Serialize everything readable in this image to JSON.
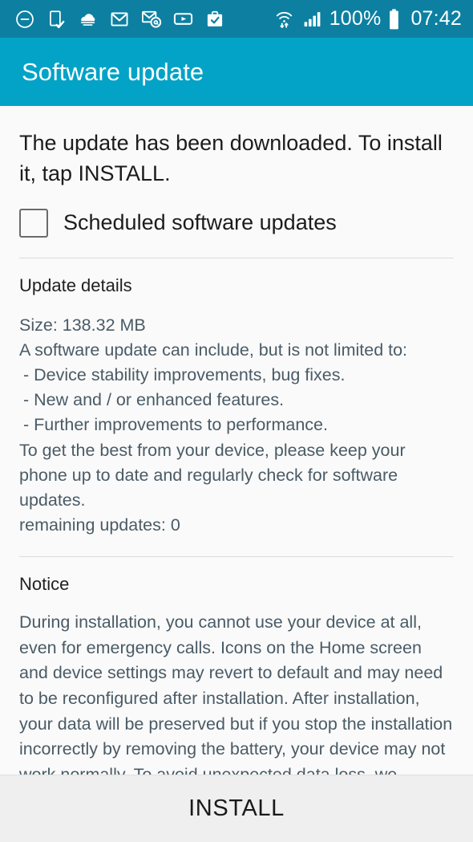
{
  "status_bar": {
    "background_color": "#0d80a2",
    "left_icons": [
      {
        "name": "do-not-disturb-icon",
        "glyph": "⊖"
      },
      {
        "name": "device-check-icon",
        "glyph": "device"
      },
      {
        "name": "cloud-icon",
        "glyph": "cloud"
      },
      {
        "name": "gmail-icon",
        "glyph": "M"
      },
      {
        "name": "email-at-icon",
        "glyph": "@"
      },
      {
        "name": "youtube-icon",
        "glyph": "▶"
      },
      {
        "name": "briefcase-check-icon",
        "glyph": "briefcase"
      }
    ],
    "wifi_icon": "wifi-transfer-icon",
    "signal_icon": "cellular-signal-icon",
    "battery_percent": "100%",
    "battery_icon": "battery-full-icon",
    "clock": "07:42"
  },
  "app_bar": {
    "title": "Software update",
    "background_color": "#03a3c7"
  },
  "main": {
    "headline": "The update has been downloaded. To install it, tap INSTALL.",
    "checkbox": {
      "label": "Scheduled software updates",
      "checked": false
    },
    "update_details": {
      "heading": "Update details",
      "size": "Size: 138.32 MB",
      "intro": "A software update can include, but is not limited to:",
      "bullets": [
        " - Device stability improvements, bug fixes.",
        " - New and / or enhanced features.",
        " - Further improvements to performance."
      ],
      "outro": "To get the best from your device, please keep your phone up to date and regularly check for software updates.",
      "remaining": "remaining updates: 0"
    },
    "notice": {
      "heading": "Notice",
      "body": "During installation, you cannot use your device at all, even for emergency calls. Icons on the Home screen and device settings may revert to default and may need to be reconfigured after installation. After installation, your data will be preserved but if you stop the installation incorrectly by removing the battery, your device may not work normally. To avoid unexpected data loss, we recommend that you back up important data before installation."
    }
  },
  "bottom_bar": {
    "install_label": "INSTALL"
  }
}
